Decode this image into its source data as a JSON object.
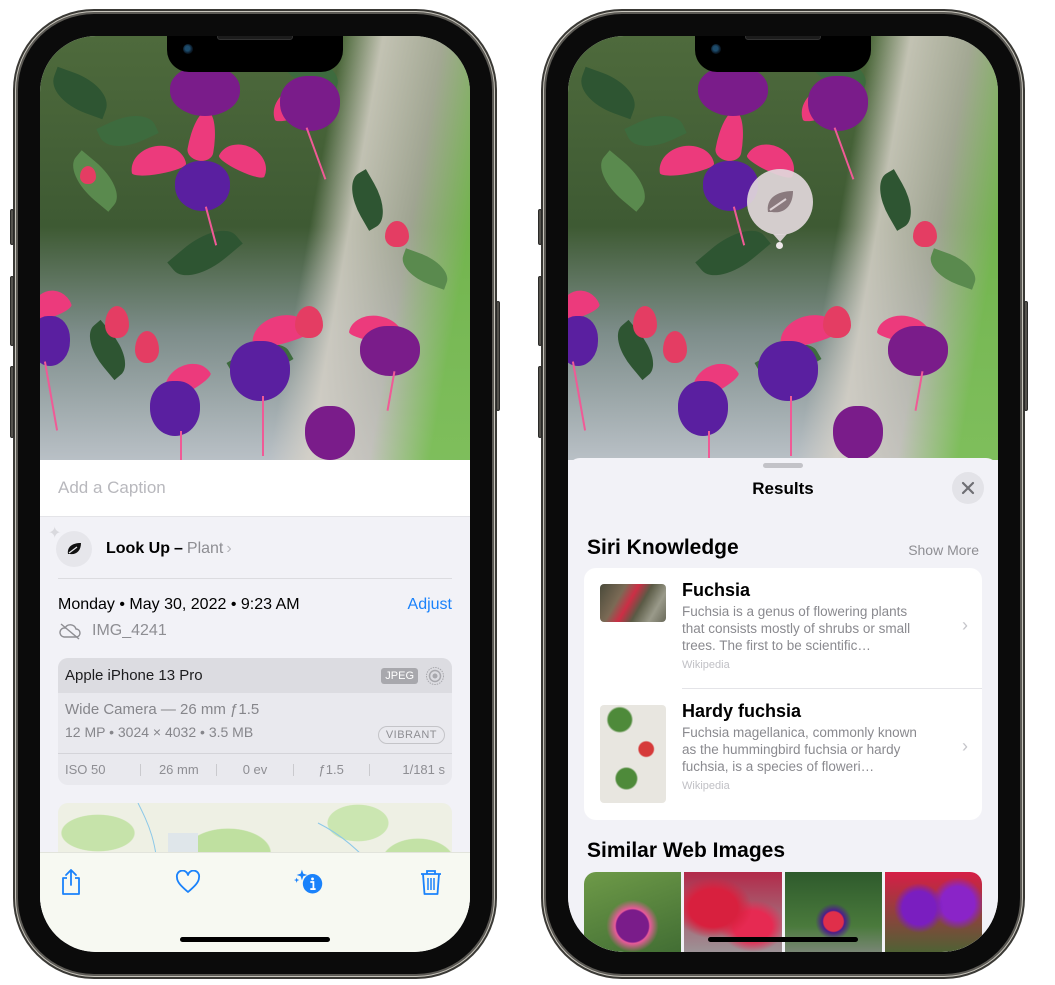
{
  "left_phone": {
    "caption_placeholder": "Add a Caption",
    "look_up": {
      "label": "Look Up",
      "separator": "–",
      "kind": "Plant",
      "icon": "leaf-icon"
    },
    "datetime": "Monday • May 30, 2022 • 9:23 AM",
    "adjust_label": "Adjust",
    "filename": "IMG_4241",
    "filename_icon": "cloud-slash-icon",
    "exif": {
      "device": "Apple iPhone 13 Pro",
      "format_badge": "JPEG",
      "lens": "Wide Camera — 26 mm ƒ1.5",
      "specs": "12 MP • 3024 × 4032 • 3.5 MB",
      "style_badge": "VIBRANT",
      "values": [
        "ISO 50",
        "26 mm",
        "0 ev",
        "ƒ1.5",
        "1/181 s"
      ]
    },
    "toolbar": [
      {
        "name": "share",
        "icon": "share-icon"
      },
      {
        "name": "favorite",
        "icon": "heart-icon"
      },
      {
        "name": "info",
        "icon": "info-sparkle-icon"
      },
      {
        "name": "delete",
        "icon": "trash-icon"
      }
    ],
    "accent": "#1a82fb"
  },
  "right_phone": {
    "sheet_title": "Results",
    "siri_knowledge": {
      "title": "Siri Knowledge",
      "show_more": "Show More",
      "items": [
        {
          "title": "Fuchsia",
          "description": "Fuchsia is a genus of flowering plants that consists mostly of shrubs or small trees. The first to be scientific…",
          "source": "Wikipedia"
        },
        {
          "title": "Hardy fuchsia",
          "description": "Fuchsia magellanica, commonly known as the hummingbird fuchsia or hardy fuchsia, is a species of floweri…",
          "source": "Wikipedia"
        }
      ]
    },
    "similar_web_images": {
      "title": "Similar Web Images",
      "count": 4
    }
  }
}
